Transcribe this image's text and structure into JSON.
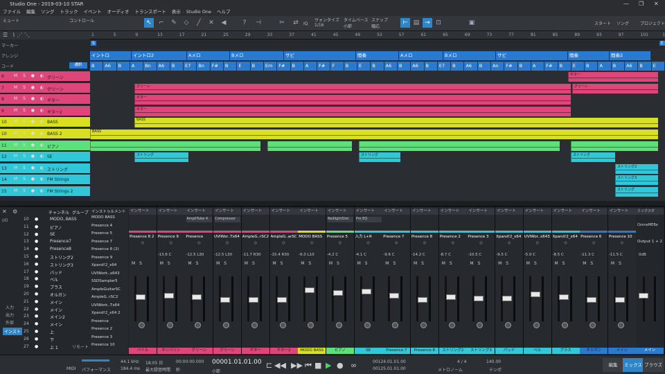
{
  "window": {
    "title": "Studio One - 2019-03-10 STAR",
    "controls": [
      "—",
      "❐",
      "✕"
    ]
  },
  "menu": [
    "ファイル",
    "編集",
    "ソング",
    "トラック",
    "イベント",
    "オーディオ",
    "トランスポート",
    "表示",
    "Studio One",
    "ヘルプ"
  ],
  "toolbar": {
    "mute": "ミュート",
    "control": "コントロール",
    "quantize": {
      "label": "ウォンタイズ",
      "value": "1/16"
    },
    "timebase": {
      "label": "タイムベース",
      "value": "小節"
    },
    "snap": {
      "label": "スナップ",
      "value": "幅応"
    },
    "iq": "IQ",
    "start": "スタート",
    "song": "ソング",
    "project": "プロジェクト"
  },
  "ruler": [
    "1",
    "5",
    "9",
    "13",
    "17",
    "21",
    "25",
    "29",
    "33",
    "37",
    "41",
    "45",
    "49",
    "53",
    "57",
    "61",
    "65",
    "69",
    "73",
    "77",
    "81",
    "85",
    "89",
    "93",
    "97",
    "101",
    "105"
  ],
  "tracklist_header": {
    "marker": "マーカー",
    "arrange": "アレンジ",
    "chord": "コード",
    "chord_btn": "通訳"
  },
  "sections": [
    {
      "l": "イントロ"
    },
    {
      "l": "イントロ2"
    },
    {
      "l": "Aメロ"
    },
    {
      "l": "Bメロ"
    },
    {
      "l": "サビ"
    },
    {
      "l": "間奏"
    },
    {
      "l": "Aメロ"
    },
    {
      "l": "Bメロ"
    },
    {
      "l": "サビ"
    },
    {
      "l": "間奏"
    },
    {
      "l": "間奏2"
    }
  ],
  "chords": [
    "B",
    "A6",
    "B",
    "A",
    "Bn",
    "A6",
    "B",
    "E7",
    "Bn",
    "F#",
    "B",
    "E",
    "B",
    "Em",
    "F#",
    "B",
    "A",
    "F#",
    "F",
    "B",
    "E",
    "B",
    "A6",
    "B",
    "A6",
    "B",
    "E7",
    "B",
    "A6",
    "B",
    "An",
    "F#",
    "B",
    "A",
    "F#",
    "B",
    "E",
    "B",
    "A",
    "B",
    "A6",
    "B",
    "E"
  ],
  "tracks": [
    {
      "n": "6",
      "name": "グリーン",
      "color": "#e0457a"
    },
    {
      "n": "7",
      "name": "グリーン",
      "color": "#e0457a"
    },
    {
      "n": "8",
      "name": "ギター",
      "color": "#e0457a"
    },
    {
      "n": "9",
      "name": "ギター2",
      "color": "#e0457a"
    },
    {
      "n": "10",
      "name": "BASS",
      "color": "#d8e020"
    },
    {
      "n": "10",
      "name": "BASS 2",
      "color": "#d8e020"
    },
    {
      "n": "11",
      "name": "ピアノ",
      "color": "#5ce07a"
    },
    {
      "n": "12",
      "name": "SE",
      "color": "#30c8d8"
    },
    {
      "n": "13",
      "name": "ストリング",
      "color": "#30c8d8"
    },
    {
      "n": "14",
      "name": "FM Strings",
      "color": "#30c8d8"
    },
    {
      "n": "15",
      "name": "FM Strings 2",
      "color": "#30c8d8"
    }
  ],
  "track_buttons": "M S ● ◐",
  "clip_labels": {
    "guitar": "ギター",
    "green": "グリーン",
    "bass": "BASS",
    "string": "ストリング",
    "string2": "ストリング2",
    "strings3": "ストリング3"
  },
  "mixer_header": {
    "channel": "チャンネル",
    "group": "グループ",
    "instrument": "インストゥルメント",
    "io": "I/O",
    "input": "入力",
    "output": "出力",
    "external": "外部",
    "instrument_tab": "インスト",
    "remote": "リモート",
    "bypass": "バス"
  },
  "mixer_list": [
    {
      "n": "10",
      "name": "MODO..BASS"
    },
    {
      "n": "11",
      "name": "ピアノ"
    },
    {
      "n": "12",
      "name": "SE"
    },
    {
      "n": "13",
      "name": "Presence7"
    },
    {
      "n": "14",
      "name": "Presence8"
    },
    {
      "n": "15",
      "name": "ストリング2"
    },
    {
      "n": "16",
      "name": "ストリング3"
    },
    {
      "n": "17",
      "name": "パッド"
    },
    {
      "n": "18",
      "name": "ベル"
    },
    {
      "n": "19",
      "name": "ブラス"
    },
    {
      "n": "20",
      "name": "オルガン"
    },
    {
      "n": "21",
      "name": "メイン"
    },
    {
      "n": "22",
      "name": "メイン"
    },
    {
      "n": "23",
      "name": "メイン2"
    },
    {
      "n": "24",
      "name": "メイン"
    },
    {
      "n": "25",
      "name": "上"
    },
    {
      "n": "26",
      "name": "下"
    },
    {
      "n": "27",
      "name": "上 1"
    }
  ],
  "instrument_list": [
    "MODO BASS",
    "Presence 4",
    "Presence 5",
    "Presence 7",
    "Presence 8 (2)",
    "Presence 9",
    "Xpand!2_x64",
    "UVIWork..x643",
    "SSDSampler5",
    "AmpleGuitarSC",
    "AmpleG..rSC2",
    "UVIWork..Tx64",
    "Xpand!2_x64 2",
    "Presence",
    "Presence 2",
    "Presence 3",
    "Presence 10"
  ],
  "channels": [
    {
      "name": "Presence 8 2",
      "val": "",
      "ins": "インサート",
      "lbl": "バイル",
      "color": "#e0457a"
    },
    {
      "name": "Presence 9",
      "val": "-13.6  C",
      "ins": "インサート",
      "lbl": "タンバリン",
      "color": "#e0457a"
    },
    {
      "name": "Presence",
      "val": "-12.5  L30",
      "ins": "インサート",
      "lbl": "グリーン",
      "color": "#e0457a",
      "plugin": "AmpliTube 4"
    },
    {
      "name": "UVIWor..Tx64",
      "val": "-12.5  L30",
      "ins": "インサート",
      "lbl": "グリーン",
      "color": "#e0457a",
      "plugin": "Compressor"
    },
    {
      "name": "AmpleG..rSC2",
      "val": "-11.7  R30",
      "ins": "インサート",
      "lbl": "ギター",
      "color": "#e0457a"
    },
    {
      "name": "AmpleG..arSC",
      "val": "-15.4  R30",
      "ins": "インサート",
      "lbl": "ギター2",
      "color": "#e0457a"
    },
    {
      "name": "MODO BASS",
      "val": "-6.0  L10",
      "ins": "インサート",
      "lbl": "MODO BASS",
      "color": "#d8e020"
    },
    {
      "name": "Presence 5",
      "val": "-4.2  C",
      "ins": "インサート",
      "lbl": "ピアノ",
      "color": "#5ce07a",
      "plugin": "RedlightDist"
    },
    {
      "name": "入力 L+R",
      "val": "-4.1  C",
      "ins": "インサート",
      "lbl": "SE",
      "color": "#30c8d8",
      "plugin": "Pro EQ"
    },
    {
      "name": "Presence 7",
      "val": "-9.6  C",
      "ins": "インサート",
      "lbl": "Presence 7",
      "color": "#30c8d8"
    },
    {
      "name": "Presence 8",
      "val": "-14.2  C",
      "ins": "インサート",
      "lbl": "Presence 8",
      "color": "#30c8d8"
    },
    {
      "name": "Presence 2",
      "val": "-8.7  C",
      "ins": "インサート",
      "lbl": "ストリング2",
      "color": "#30c8d8"
    },
    {
      "name": "Presence 3",
      "val": "-10.5  C",
      "ins": "インサート",
      "lbl": "ストリング3",
      "color": "#30c8d8"
    },
    {
      "name": "Xpand!2_x64",
      "val": "-9.5  C",
      "ins": "インサート",
      "lbl": "パッド",
      "color": "#30c8d8"
    },
    {
      "name": "UVIWor..x643",
      "val": "-5.0  C",
      "ins": "インサート",
      "lbl": "ベル",
      "color": "#30c8d8"
    },
    {
      "name": "Xpand!2_x64",
      "val": "-8.5  C",
      "ins": "インサート",
      "lbl": "ブラス",
      "color": "#30c8d8"
    },
    {
      "name": "Presence 6",
      "val": "-11.3  C",
      "ins": "インサート",
      "lbl": "オルガン",
      "color": "#2a7bd0"
    },
    {
      "name": "Presence 10",
      "val": "-11.5  C",
      "ins": "インサート",
      "lbl": "メイン",
      "color": "#2a7bd0"
    }
  ],
  "main_out": {
    "name": "Output 1 + 2",
    "ins": "ミックスダ",
    "plugin": "OzoneMEBe",
    "val": "0dB",
    "label": "メイン"
  },
  "transport": {
    "midi": "MIDI",
    "perf": "パフォーマンス",
    "rate": "44.1 kHz",
    "latency": "184.4 ms",
    "time": "18:05 日",
    "rec_max": "最大録音時間",
    "timecode": "00:00:00.000",
    "timecode_lbl": "秒",
    "position": "00001.01.01.00",
    "position_lbl": "小節",
    "loop_start": "00124.01.01.00",
    "loop_end": "00125.01.01.00",
    "sig": "4 / 4",
    "tempo": "140.00",
    "metronome": "メトロノーム",
    "tempo_lbl": "テンポ",
    "tabs": [
      "編集",
      "ミックス",
      "ブラウズ"
    ]
  }
}
